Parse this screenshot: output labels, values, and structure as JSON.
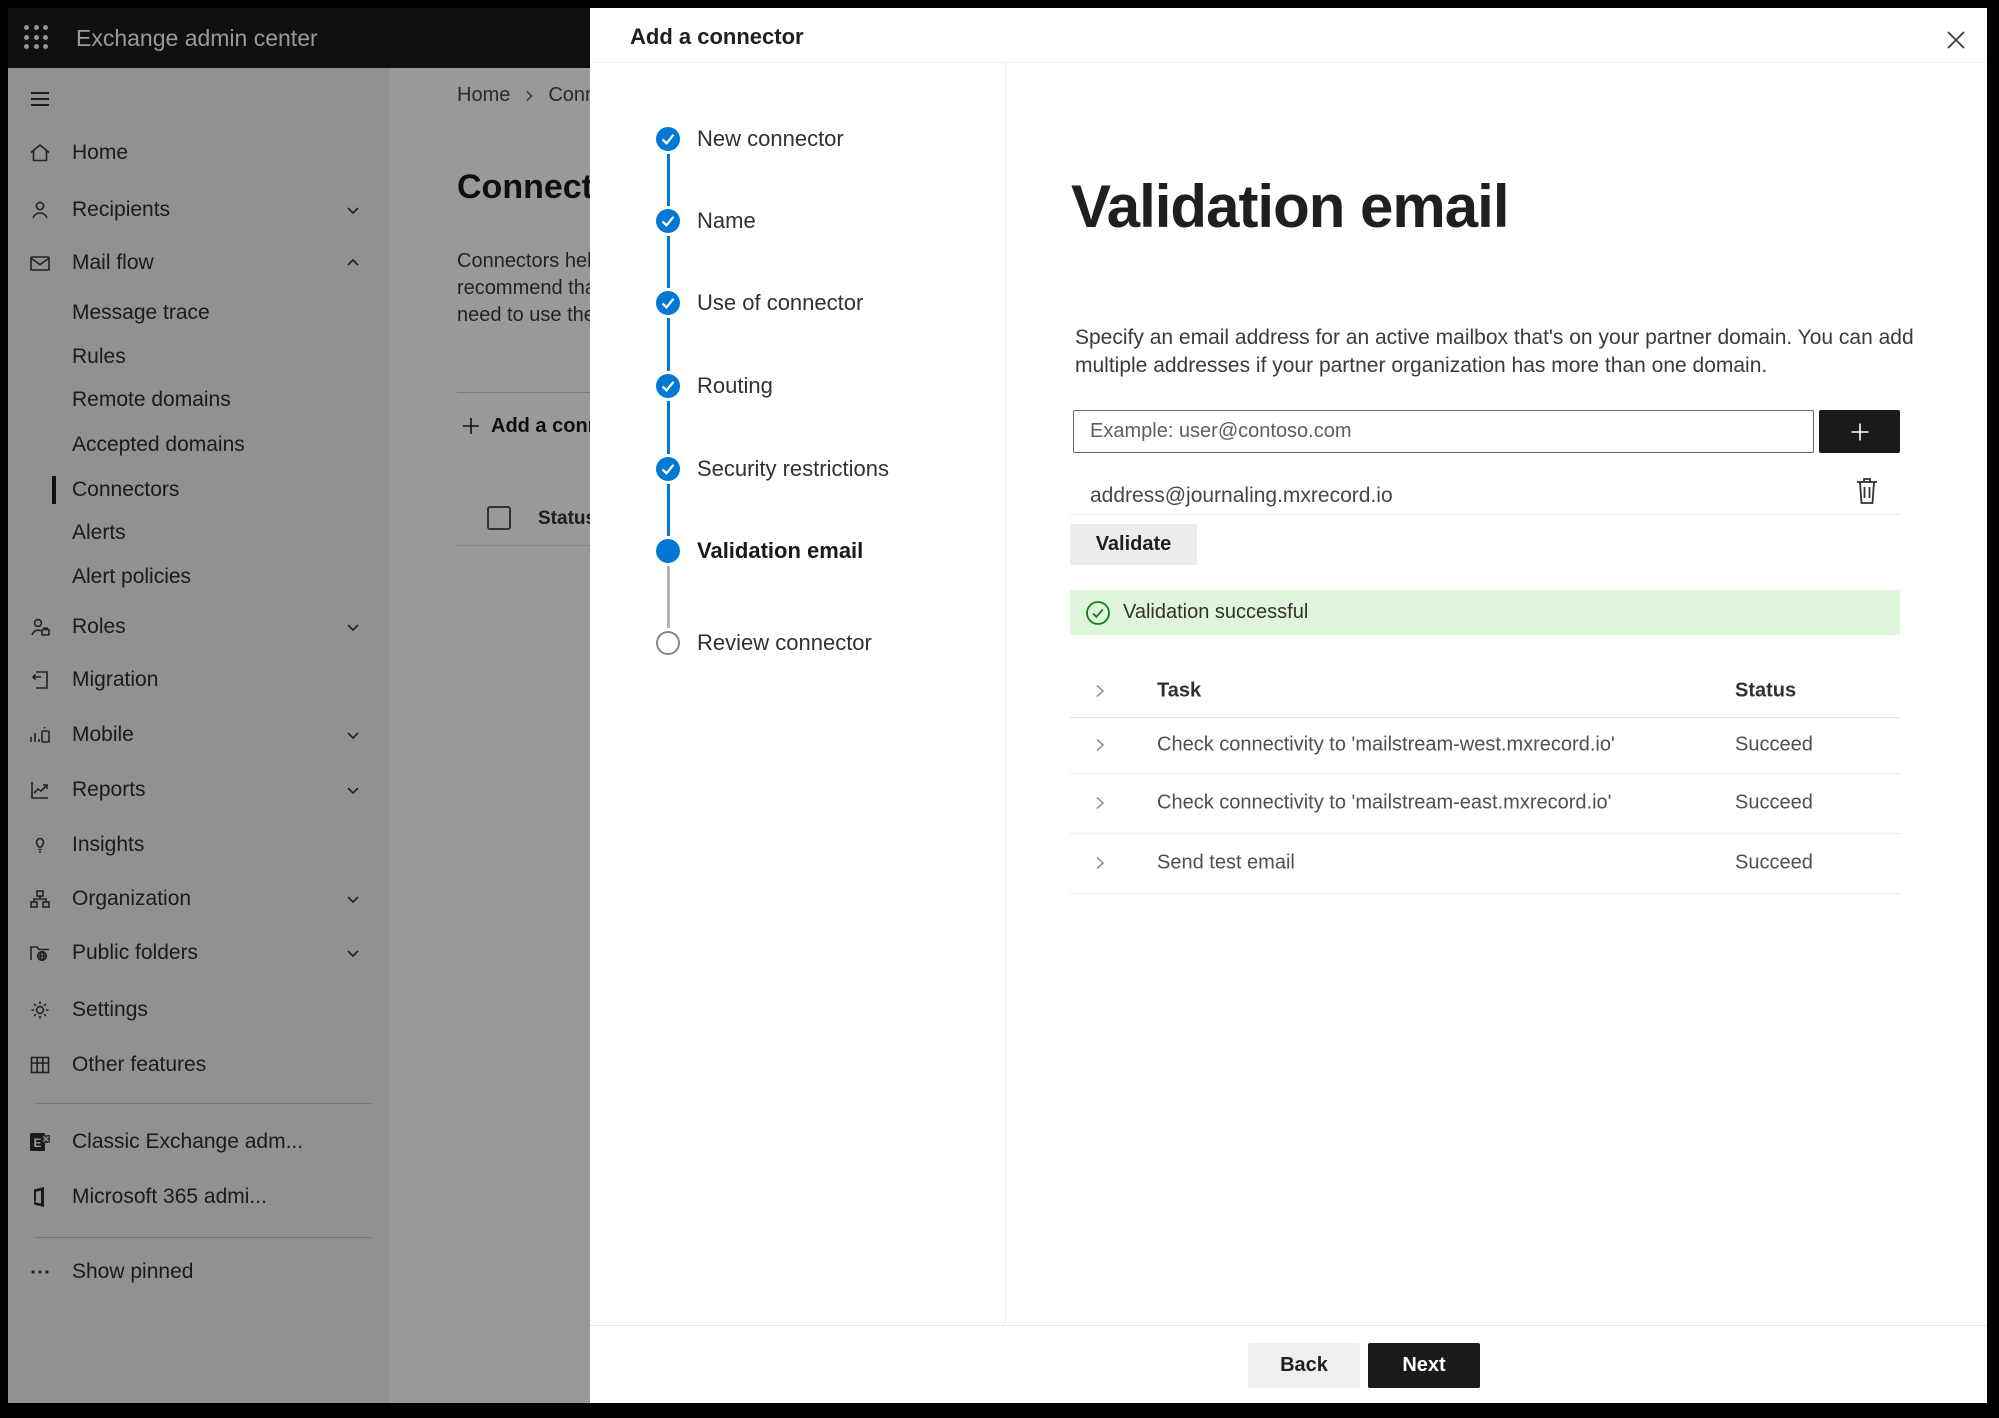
{
  "topbar": {
    "title": "Exchange admin center"
  },
  "sidebar": {
    "items": [
      {
        "label": "Home"
      },
      {
        "label": "Recipients"
      },
      {
        "label": "Mail flow"
      },
      {
        "label": "Message trace"
      },
      {
        "label": "Rules"
      },
      {
        "label": "Remote domains"
      },
      {
        "label": "Accepted domains"
      },
      {
        "label": "Connectors"
      },
      {
        "label": "Alerts"
      },
      {
        "label": "Alert policies"
      },
      {
        "label": "Roles"
      },
      {
        "label": "Migration"
      },
      {
        "label": "Mobile"
      },
      {
        "label": "Reports"
      },
      {
        "label": "Insights"
      },
      {
        "label": "Organization"
      },
      {
        "label": "Public folders"
      },
      {
        "label": "Settings"
      },
      {
        "label": "Other features"
      },
      {
        "label": "Classic Exchange adm..."
      },
      {
        "label": "Microsoft 365 admi..."
      },
      {
        "label": "Show pinned"
      }
    ]
  },
  "background": {
    "breadcrumb_home": "Home",
    "breadcrumb_current": "Connectors",
    "page_title": "Connectors",
    "intro_line1": "Connectors help",
    "intro_line2": "recommend that",
    "intro_line3": "need to use ther",
    "add_connector_label": "Add a connector",
    "status_column": "Status"
  },
  "wizard": {
    "title": "Add a connector",
    "steps": [
      {
        "label": "New connector",
        "state": "complete"
      },
      {
        "label": "Name",
        "state": "complete"
      },
      {
        "label": "Use of connector",
        "state": "complete"
      },
      {
        "label": "Routing",
        "state": "complete"
      },
      {
        "label": "Security restrictions",
        "state": "complete"
      },
      {
        "label": "Validation email",
        "state": "current"
      },
      {
        "label": "Review connector",
        "state": "upcoming"
      }
    ]
  },
  "content": {
    "heading": "Validation email",
    "description": "Specify an email address for an active mailbox that's on your partner domain. You can add multiple addresses if your partner organization has more than one domain.",
    "email_placeholder": "Example: user@contoso.com",
    "address": "address@journaling.mxrecord.io",
    "validate_label": "Validate",
    "banner_text": "Validation successful",
    "table": {
      "task_header": "Task",
      "status_header": "Status",
      "rows": [
        {
          "task": "Check connectivity to 'mailstream-west.mxrecord.io'",
          "status": "Succeed"
        },
        {
          "task": "Check connectivity to 'mailstream-east.mxrecord.io'",
          "status": "Succeed"
        },
        {
          "task": "Send test email",
          "status": "Succeed"
        }
      ]
    }
  },
  "footer": {
    "back_label": "Back",
    "next_label": "Next"
  },
  "colors": {
    "accent": "#0078d4",
    "success_bg": "#dff6dd",
    "success_green": "#107c10"
  }
}
